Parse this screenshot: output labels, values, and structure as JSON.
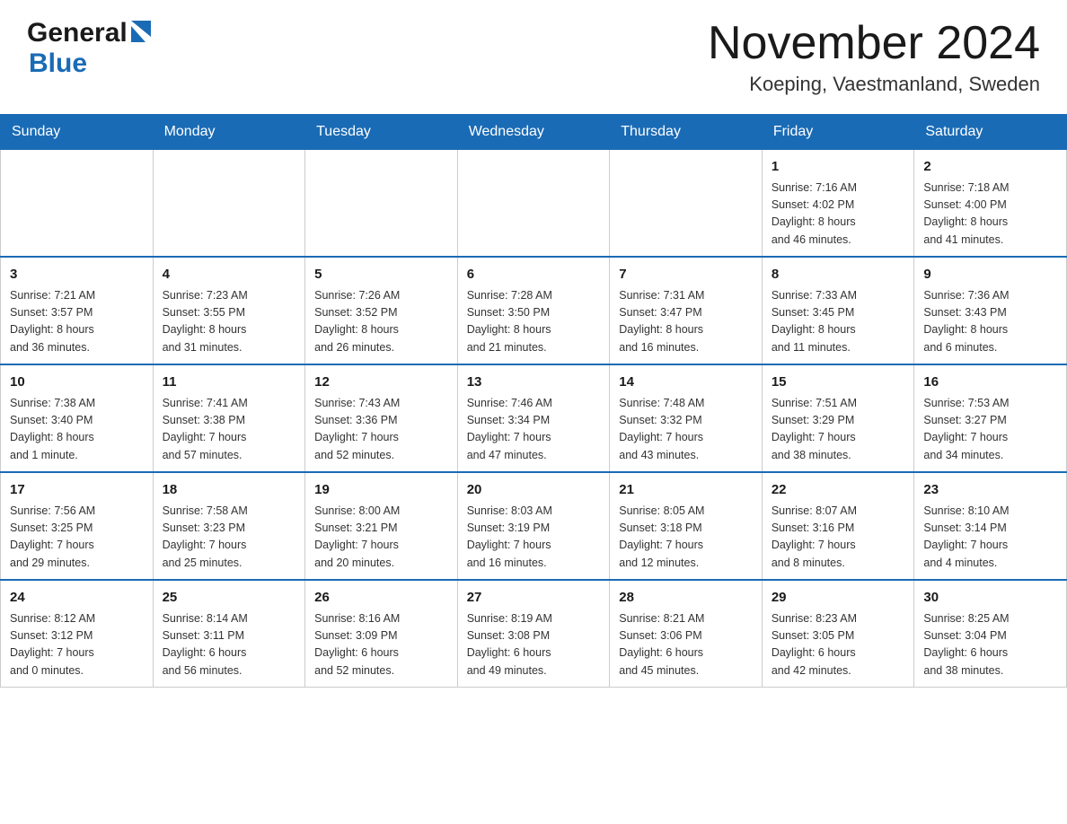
{
  "logo": {
    "general": "General",
    "blue": "Blue"
  },
  "title": {
    "month": "November 2024",
    "location": "Koeping, Vaestmanland, Sweden"
  },
  "weekdays": [
    "Sunday",
    "Monday",
    "Tuesday",
    "Wednesday",
    "Thursday",
    "Friday",
    "Saturday"
  ],
  "weeks": [
    [
      {
        "day": "",
        "info": ""
      },
      {
        "day": "",
        "info": ""
      },
      {
        "day": "",
        "info": ""
      },
      {
        "day": "",
        "info": ""
      },
      {
        "day": "",
        "info": ""
      },
      {
        "day": "1",
        "info": "Sunrise: 7:16 AM\nSunset: 4:02 PM\nDaylight: 8 hours\nand 46 minutes."
      },
      {
        "day": "2",
        "info": "Sunrise: 7:18 AM\nSunset: 4:00 PM\nDaylight: 8 hours\nand 41 minutes."
      }
    ],
    [
      {
        "day": "3",
        "info": "Sunrise: 7:21 AM\nSunset: 3:57 PM\nDaylight: 8 hours\nand 36 minutes."
      },
      {
        "day": "4",
        "info": "Sunrise: 7:23 AM\nSunset: 3:55 PM\nDaylight: 8 hours\nand 31 minutes."
      },
      {
        "day": "5",
        "info": "Sunrise: 7:26 AM\nSunset: 3:52 PM\nDaylight: 8 hours\nand 26 minutes."
      },
      {
        "day": "6",
        "info": "Sunrise: 7:28 AM\nSunset: 3:50 PM\nDaylight: 8 hours\nand 21 minutes."
      },
      {
        "day": "7",
        "info": "Sunrise: 7:31 AM\nSunset: 3:47 PM\nDaylight: 8 hours\nand 16 minutes."
      },
      {
        "day": "8",
        "info": "Sunrise: 7:33 AM\nSunset: 3:45 PM\nDaylight: 8 hours\nand 11 minutes."
      },
      {
        "day": "9",
        "info": "Sunrise: 7:36 AM\nSunset: 3:43 PM\nDaylight: 8 hours\nand 6 minutes."
      }
    ],
    [
      {
        "day": "10",
        "info": "Sunrise: 7:38 AM\nSunset: 3:40 PM\nDaylight: 8 hours\nand 1 minute."
      },
      {
        "day": "11",
        "info": "Sunrise: 7:41 AM\nSunset: 3:38 PM\nDaylight: 7 hours\nand 57 minutes."
      },
      {
        "day": "12",
        "info": "Sunrise: 7:43 AM\nSunset: 3:36 PM\nDaylight: 7 hours\nand 52 minutes."
      },
      {
        "day": "13",
        "info": "Sunrise: 7:46 AM\nSunset: 3:34 PM\nDaylight: 7 hours\nand 47 minutes."
      },
      {
        "day": "14",
        "info": "Sunrise: 7:48 AM\nSunset: 3:32 PM\nDaylight: 7 hours\nand 43 minutes."
      },
      {
        "day": "15",
        "info": "Sunrise: 7:51 AM\nSunset: 3:29 PM\nDaylight: 7 hours\nand 38 minutes."
      },
      {
        "day": "16",
        "info": "Sunrise: 7:53 AM\nSunset: 3:27 PM\nDaylight: 7 hours\nand 34 minutes."
      }
    ],
    [
      {
        "day": "17",
        "info": "Sunrise: 7:56 AM\nSunset: 3:25 PM\nDaylight: 7 hours\nand 29 minutes."
      },
      {
        "day": "18",
        "info": "Sunrise: 7:58 AM\nSunset: 3:23 PM\nDaylight: 7 hours\nand 25 minutes."
      },
      {
        "day": "19",
        "info": "Sunrise: 8:00 AM\nSunset: 3:21 PM\nDaylight: 7 hours\nand 20 minutes."
      },
      {
        "day": "20",
        "info": "Sunrise: 8:03 AM\nSunset: 3:19 PM\nDaylight: 7 hours\nand 16 minutes."
      },
      {
        "day": "21",
        "info": "Sunrise: 8:05 AM\nSunset: 3:18 PM\nDaylight: 7 hours\nand 12 minutes."
      },
      {
        "day": "22",
        "info": "Sunrise: 8:07 AM\nSunset: 3:16 PM\nDaylight: 7 hours\nand 8 minutes."
      },
      {
        "day": "23",
        "info": "Sunrise: 8:10 AM\nSunset: 3:14 PM\nDaylight: 7 hours\nand 4 minutes."
      }
    ],
    [
      {
        "day": "24",
        "info": "Sunrise: 8:12 AM\nSunset: 3:12 PM\nDaylight: 7 hours\nand 0 minutes."
      },
      {
        "day": "25",
        "info": "Sunrise: 8:14 AM\nSunset: 3:11 PM\nDaylight: 6 hours\nand 56 minutes."
      },
      {
        "day": "26",
        "info": "Sunrise: 8:16 AM\nSunset: 3:09 PM\nDaylight: 6 hours\nand 52 minutes."
      },
      {
        "day": "27",
        "info": "Sunrise: 8:19 AM\nSunset: 3:08 PM\nDaylight: 6 hours\nand 49 minutes."
      },
      {
        "day": "28",
        "info": "Sunrise: 8:21 AM\nSunset: 3:06 PM\nDaylight: 6 hours\nand 45 minutes."
      },
      {
        "day": "29",
        "info": "Sunrise: 8:23 AM\nSunset: 3:05 PM\nDaylight: 6 hours\nand 42 minutes."
      },
      {
        "day": "30",
        "info": "Sunrise: 8:25 AM\nSunset: 3:04 PM\nDaylight: 6 hours\nand 38 minutes."
      }
    ]
  ]
}
